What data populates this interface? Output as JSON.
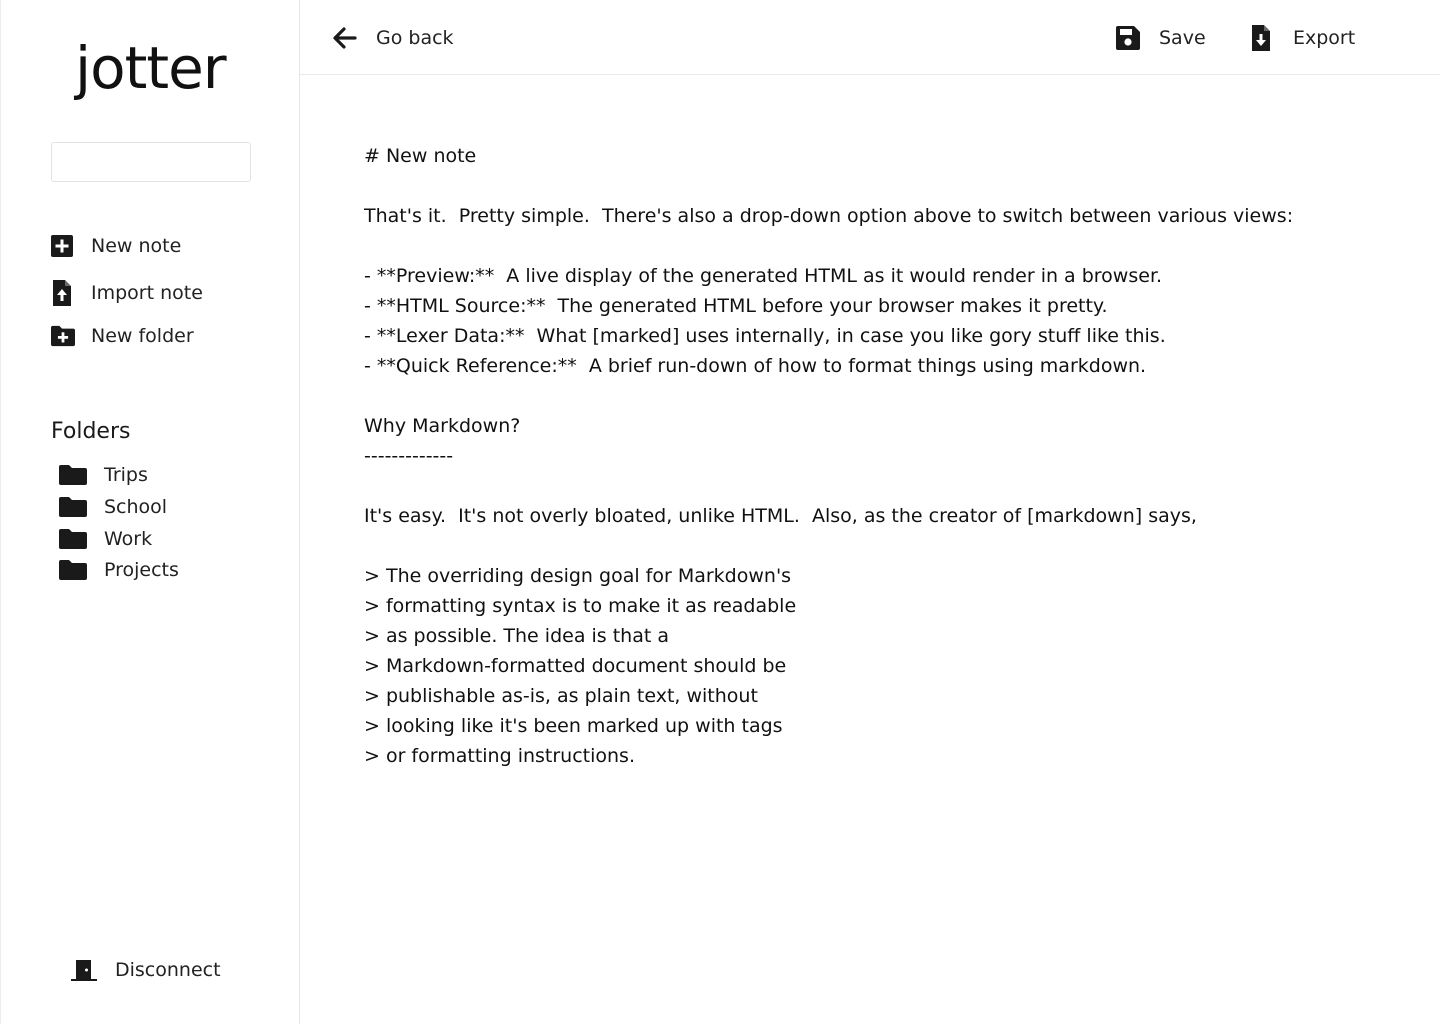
{
  "sidebar": {
    "logo": "jotter",
    "search": {
      "value": "",
      "placeholder": ""
    },
    "actions": [
      {
        "label": "New note",
        "icon": "plus-square-icon"
      },
      {
        "label": "Import note",
        "icon": "file-upload-icon"
      },
      {
        "label": "New folder",
        "icon": "folder-plus-icon"
      }
    ],
    "folders_title": "Folders",
    "folders": [
      {
        "label": "Trips",
        "icon": "folder-icon"
      },
      {
        "label": "School",
        "icon": "folder-icon"
      },
      {
        "label": "Work",
        "icon": "folder-icon"
      },
      {
        "label": "Projects",
        "icon": "folder-icon"
      }
    ],
    "disconnect": {
      "label": "Disconnect",
      "icon": "door-exit-icon"
    }
  },
  "topbar": {
    "back_label": "Go back",
    "save_label": "Save",
    "export_label": "Export"
  },
  "editor": {
    "content": "# New note\n\nThat's it.  Pretty simple.  There's also a drop-down option above to switch between various views:\n\n- **Preview:**  A live display of the generated HTML as it would render in a browser.\n- **HTML Source:**  The generated HTML before your browser makes it pretty.\n- **Lexer Data:**  What [marked] uses internally, in case you like gory stuff like this.\n- **Quick Reference:**  A brief run-down of how to format things using markdown.\n\nWhy Markdown?\n-------------\n\nIt's easy.  It's not overly bloated, unlike HTML.  Also, as the creator of [markdown] says,\n\n> The overriding design goal for Markdown's\n> formatting syntax is to make it as readable\n> as possible. The idea is that a\n> Markdown-formatted document should be\n> publishable as-is, as plain text, without\n> looking like it's been marked up with tags\n> or formatting instructions."
  }
}
